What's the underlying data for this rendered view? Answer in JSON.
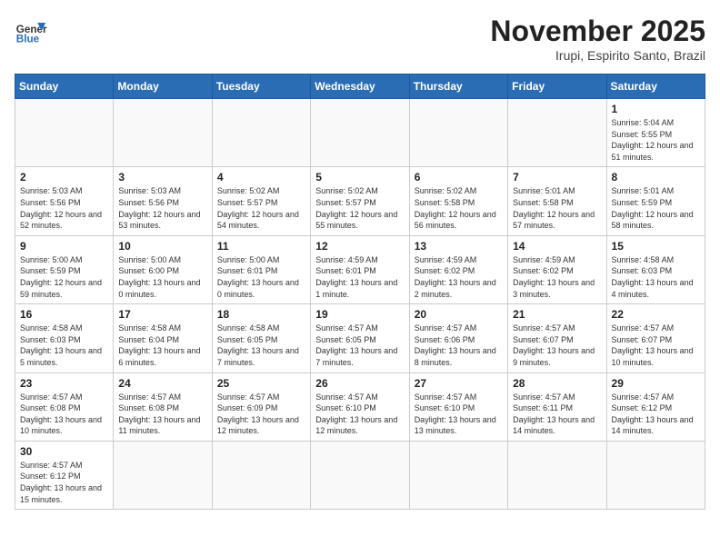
{
  "header": {
    "logo_general": "General",
    "logo_blue": "Blue",
    "title": "November 2025",
    "subtitle": "Irupi, Espirito Santo, Brazil"
  },
  "days_of_week": [
    "Sunday",
    "Monday",
    "Tuesday",
    "Wednesday",
    "Thursday",
    "Friday",
    "Saturday"
  ],
  "weeks": [
    [
      {
        "day": "",
        "info": ""
      },
      {
        "day": "",
        "info": ""
      },
      {
        "day": "",
        "info": ""
      },
      {
        "day": "",
        "info": ""
      },
      {
        "day": "",
        "info": ""
      },
      {
        "day": "",
        "info": ""
      },
      {
        "day": "1",
        "info": "Sunrise: 5:04 AM\nSunset: 5:55 PM\nDaylight: 12 hours and 51 minutes."
      }
    ],
    [
      {
        "day": "2",
        "info": "Sunrise: 5:03 AM\nSunset: 5:56 PM\nDaylight: 12 hours and 52 minutes."
      },
      {
        "day": "3",
        "info": "Sunrise: 5:03 AM\nSunset: 5:56 PM\nDaylight: 12 hours and 53 minutes."
      },
      {
        "day": "4",
        "info": "Sunrise: 5:02 AM\nSunset: 5:57 PM\nDaylight: 12 hours and 54 minutes."
      },
      {
        "day": "5",
        "info": "Sunrise: 5:02 AM\nSunset: 5:57 PM\nDaylight: 12 hours and 55 minutes."
      },
      {
        "day": "6",
        "info": "Sunrise: 5:02 AM\nSunset: 5:58 PM\nDaylight: 12 hours and 56 minutes."
      },
      {
        "day": "7",
        "info": "Sunrise: 5:01 AM\nSunset: 5:58 PM\nDaylight: 12 hours and 57 minutes."
      },
      {
        "day": "8",
        "info": "Sunrise: 5:01 AM\nSunset: 5:59 PM\nDaylight: 12 hours and 58 minutes."
      }
    ],
    [
      {
        "day": "9",
        "info": "Sunrise: 5:00 AM\nSunset: 5:59 PM\nDaylight: 12 hours and 59 minutes."
      },
      {
        "day": "10",
        "info": "Sunrise: 5:00 AM\nSunset: 6:00 PM\nDaylight: 13 hours and 0 minutes."
      },
      {
        "day": "11",
        "info": "Sunrise: 5:00 AM\nSunset: 6:01 PM\nDaylight: 13 hours and 0 minutes."
      },
      {
        "day": "12",
        "info": "Sunrise: 4:59 AM\nSunset: 6:01 PM\nDaylight: 13 hours and 1 minute."
      },
      {
        "day": "13",
        "info": "Sunrise: 4:59 AM\nSunset: 6:02 PM\nDaylight: 13 hours and 2 minutes."
      },
      {
        "day": "14",
        "info": "Sunrise: 4:59 AM\nSunset: 6:02 PM\nDaylight: 13 hours and 3 minutes."
      },
      {
        "day": "15",
        "info": "Sunrise: 4:58 AM\nSunset: 6:03 PM\nDaylight: 13 hours and 4 minutes."
      }
    ],
    [
      {
        "day": "16",
        "info": "Sunrise: 4:58 AM\nSunset: 6:03 PM\nDaylight: 13 hours and 5 minutes."
      },
      {
        "day": "17",
        "info": "Sunrise: 4:58 AM\nSunset: 6:04 PM\nDaylight: 13 hours and 6 minutes."
      },
      {
        "day": "18",
        "info": "Sunrise: 4:58 AM\nSunset: 6:05 PM\nDaylight: 13 hours and 7 minutes."
      },
      {
        "day": "19",
        "info": "Sunrise: 4:57 AM\nSunset: 6:05 PM\nDaylight: 13 hours and 7 minutes."
      },
      {
        "day": "20",
        "info": "Sunrise: 4:57 AM\nSunset: 6:06 PM\nDaylight: 13 hours and 8 minutes."
      },
      {
        "day": "21",
        "info": "Sunrise: 4:57 AM\nSunset: 6:07 PM\nDaylight: 13 hours and 9 minutes."
      },
      {
        "day": "22",
        "info": "Sunrise: 4:57 AM\nSunset: 6:07 PM\nDaylight: 13 hours and 10 minutes."
      }
    ],
    [
      {
        "day": "23",
        "info": "Sunrise: 4:57 AM\nSunset: 6:08 PM\nDaylight: 13 hours and 10 minutes."
      },
      {
        "day": "24",
        "info": "Sunrise: 4:57 AM\nSunset: 6:08 PM\nDaylight: 13 hours and 11 minutes."
      },
      {
        "day": "25",
        "info": "Sunrise: 4:57 AM\nSunset: 6:09 PM\nDaylight: 13 hours and 12 minutes."
      },
      {
        "day": "26",
        "info": "Sunrise: 4:57 AM\nSunset: 6:10 PM\nDaylight: 13 hours and 12 minutes."
      },
      {
        "day": "27",
        "info": "Sunrise: 4:57 AM\nSunset: 6:10 PM\nDaylight: 13 hours and 13 minutes."
      },
      {
        "day": "28",
        "info": "Sunrise: 4:57 AM\nSunset: 6:11 PM\nDaylight: 13 hours and 14 minutes."
      },
      {
        "day": "29",
        "info": "Sunrise: 4:57 AM\nSunset: 6:12 PM\nDaylight: 13 hours and 14 minutes."
      }
    ],
    [
      {
        "day": "30",
        "info": "Sunrise: 4:57 AM\nSunset: 6:12 PM\nDaylight: 13 hours and 15 minutes."
      },
      {
        "day": "",
        "info": ""
      },
      {
        "day": "",
        "info": ""
      },
      {
        "day": "",
        "info": ""
      },
      {
        "day": "",
        "info": ""
      },
      {
        "day": "",
        "info": ""
      },
      {
        "day": "",
        "info": ""
      }
    ]
  ]
}
